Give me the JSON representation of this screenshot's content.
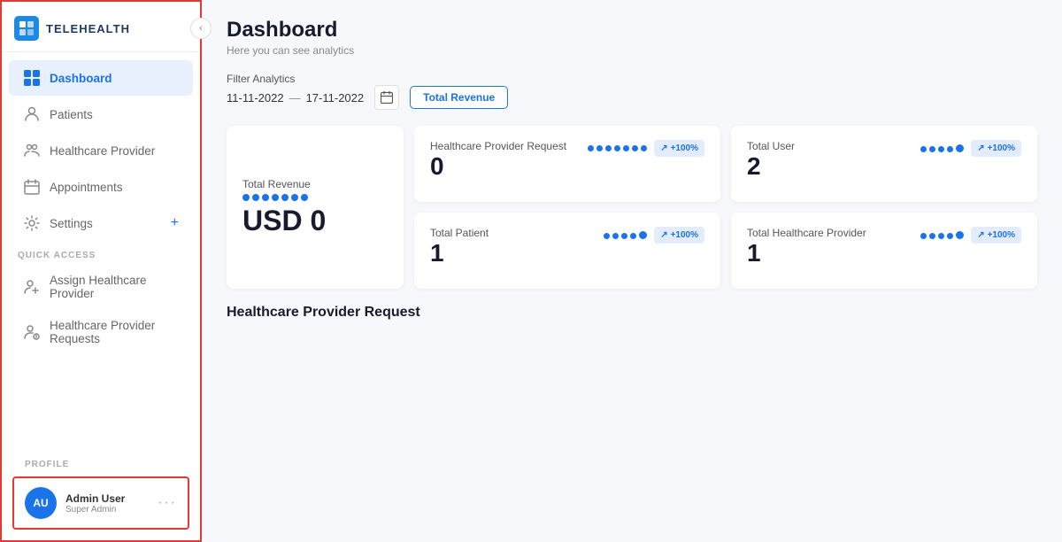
{
  "sidebar": {
    "logo_text": "TELEHEALTH",
    "nav_items": [
      {
        "id": "dashboard",
        "label": "Dashboard",
        "icon": "⊞",
        "active": true
      },
      {
        "id": "patients",
        "label": "Patients",
        "icon": "👤",
        "active": false
      },
      {
        "id": "healthcare-provider",
        "label": "Healthcare Provider",
        "icon": "👥",
        "active": false
      },
      {
        "id": "appointments",
        "label": "Appointments",
        "icon": "📅",
        "active": false
      },
      {
        "id": "settings",
        "label": "Settings",
        "icon": "⚙",
        "active": false,
        "plus": true
      }
    ],
    "quick_access_label": "QUICK ACCESS",
    "quick_access_items": [
      {
        "id": "assign-hp",
        "label": "Assign Healthcare Provider",
        "icon": "👥"
      },
      {
        "id": "hp-requests",
        "label": "Healthcare Provider Requests",
        "icon": "👥"
      }
    ],
    "profile_section": {
      "label": "PROFILE",
      "avatar_initials": "AU",
      "name": "Admin User",
      "role": "Super Admin",
      "dots": "···"
    }
  },
  "main": {
    "page_title": "Dashboard",
    "page_subtitle": "Here you can see analytics",
    "filter": {
      "label": "Filter Analytics",
      "date_from": "11-11-2022",
      "date_dash": "—",
      "date_to": "17-11-2022",
      "button_label": "Total Revenue"
    },
    "stats": [
      {
        "id": "revenue",
        "title": "Total Revenue",
        "value": "USD 0",
        "type": "revenue"
      },
      {
        "id": "hp-request",
        "title": "Healthcare Provider Request",
        "value": "0",
        "badge": "+100%"
      },
      {
        "id": "total-user",
        "title": "Total User",
        "value": "2",
        "badge": "+100%"
      },
      {
        "id": "total-patient",
        "title": "Total Patient",
        "value": "1",
        "badge": "+100%"
      },
      {
        "id": "total-hp",
        "title": "Total Healthcare Provider",
        "value": "1",
        "badge": "+100%"
      }
    ],
    "bottom_section_title": "Healthcare Provider Request"
  }
}
